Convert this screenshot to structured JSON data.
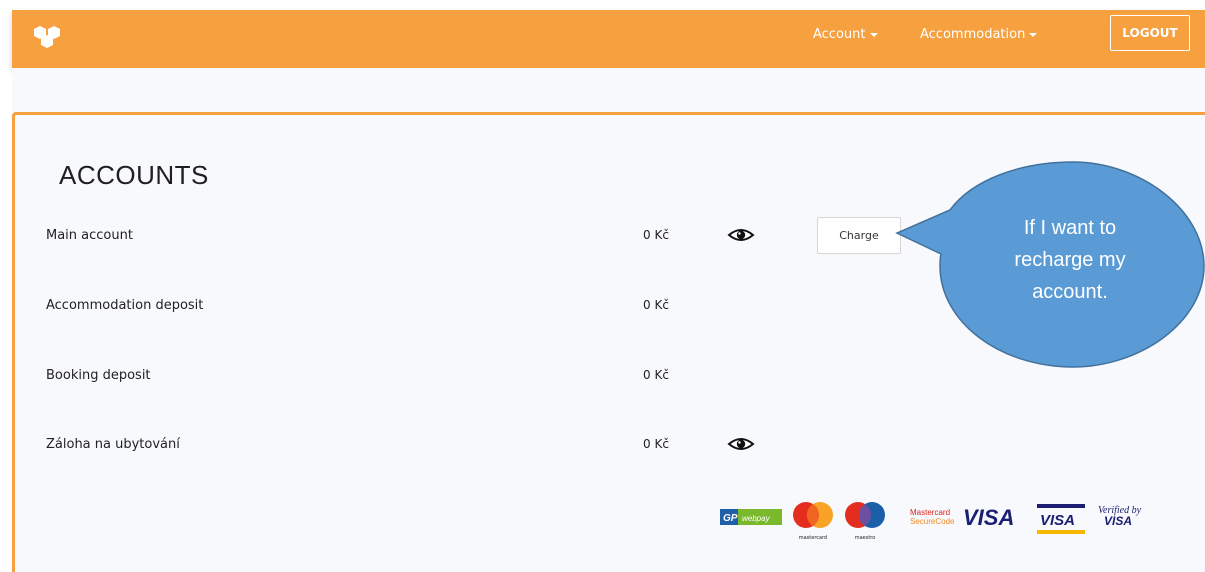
{
  "nav": {
    "account_label": "Account",
    "accommodation_label": "Accommodation",
    "logout_label": "LOGOUT"
  },
  "page": {
    "title": "ACCOUNTS"
  },
  "accounts": [
    {
      "name": "Main account",
      "amount": "0 Kč",
      "has_eye": true,
      "has_charge": true,
      "charge_label": "Charge"
    },
    {
      "name": "Accommodation deposit",
      "amount": "0 Kč",
      "has_eye": false
    },
    {
      "name": "Booking deposit",
      "amount": "0 Kč",
      "has_eye": false
    },
    {
      "name": "Záloha na ubytování",
      "amount": "0 Kč",
      "has_eye": true
    }
  ],
  "payment_logos": {
    "gpwebpay_gp": "GP",
    "gpwebpay_text": "webpay",
    "mastercard_caption": "mastercard",
    "maestro_caption": "maestro",
    "securecode_line1": "Mastercard",
    "securecode_line2": "SecureCode",
    "visa": "VISA",
    "visa_electron": "VISA",
    "verified_line1": "Verified by",
    "verified_line2": "VISA"
  },
  "callout": {
    "text": "If I want to recharge my account."
  },
  "colors": {
    "brand": "#f7a03f",
    "callout_fill": "#5b9bd5",
    "callout_border": "#41719c"
  }
}
